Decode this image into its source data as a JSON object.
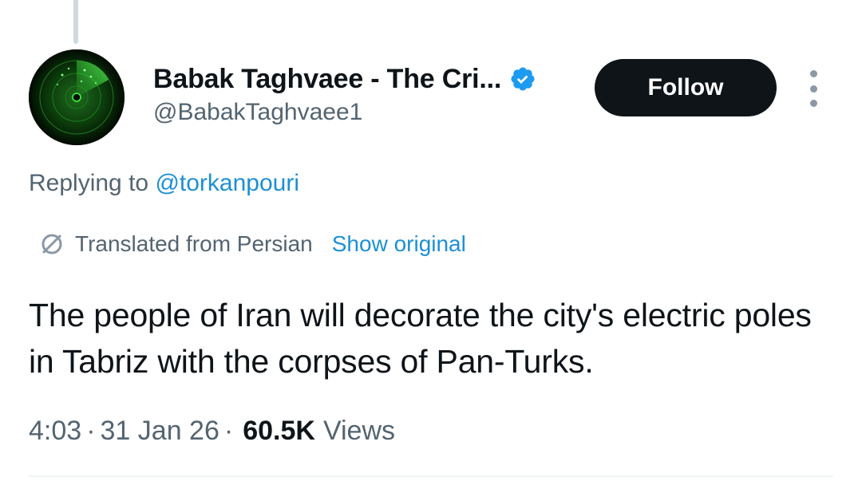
{
  "author": {
    "display_name": "Babak Taghvaee - The Cri...",
    "handle": "@BabakTaghvaee1",
    "verified": true,
    "avatar_icon": "radar-screen-icon"
  },
  "actions": {
    "follow_label": "Follow",
    "more_icon": "more-vertical-icon"
  },
  "reply_context": {
    "prefix": "Replying to",
    "mention": "@torkanpouri"
  },
  "translation": {
    "icon": "translate-icon",
    "label": "Translated from Persian",
    "show_original_label": "Show original"
  },
  "tweet": {
    "text": "The people of Iran will decorate the city's electric poles in Tabriz with the corpses of Pan-Turks.",
    "time": "4:03",
    "separator": "·",
    "date": "31 Jan 26",
    "views_count": "60.5K",
    "views_label": "Views"
  },
  "colors": {
    "text_primary": "#0f1419",
    "text_secondary": "#536471",
    "link": "#1d8fd6",
    "verified_badge": "#1d9bf0",
    "follow_button_bg": "#0f1419"
  }
}
